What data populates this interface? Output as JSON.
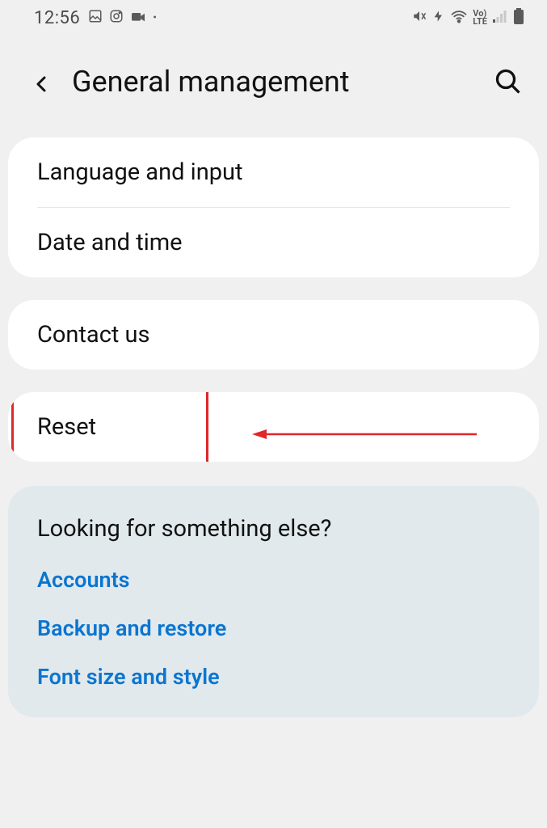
{
  "status": {
    "time": "12:56",
    "left_icons": [
      "gallery-icon",
      "instagram-icon",
      "camera-icon",
      "dot-icon"
    ],
    "right_icons": [
      "mute-icon",
      "data-saver-icon",
      "wifi-icon",
      "volte-icon",
      "signal-icon",
      "battery-icon"
    ]
  },
  "header": {
    "title": "General management"
  },
  "groups": [
    {
      "items": [
        {
          "label": "Language and input"
        },
        {
          "label": "Date and time"
        }
      ]
    },
    {
      "items": [
        {
          "label": "Contact us"
        }
      ]
    },
    {
      "items": [
        {
          "label": "Reset"
        }
      ],
      "highlighted": true
    }
  ],
  "suggestions": {
    "heading": "Looking for something else?",
    "links": [
      "Accounts",
      "Backup and restore",
      "Font size and style"
    ]
  }
}
